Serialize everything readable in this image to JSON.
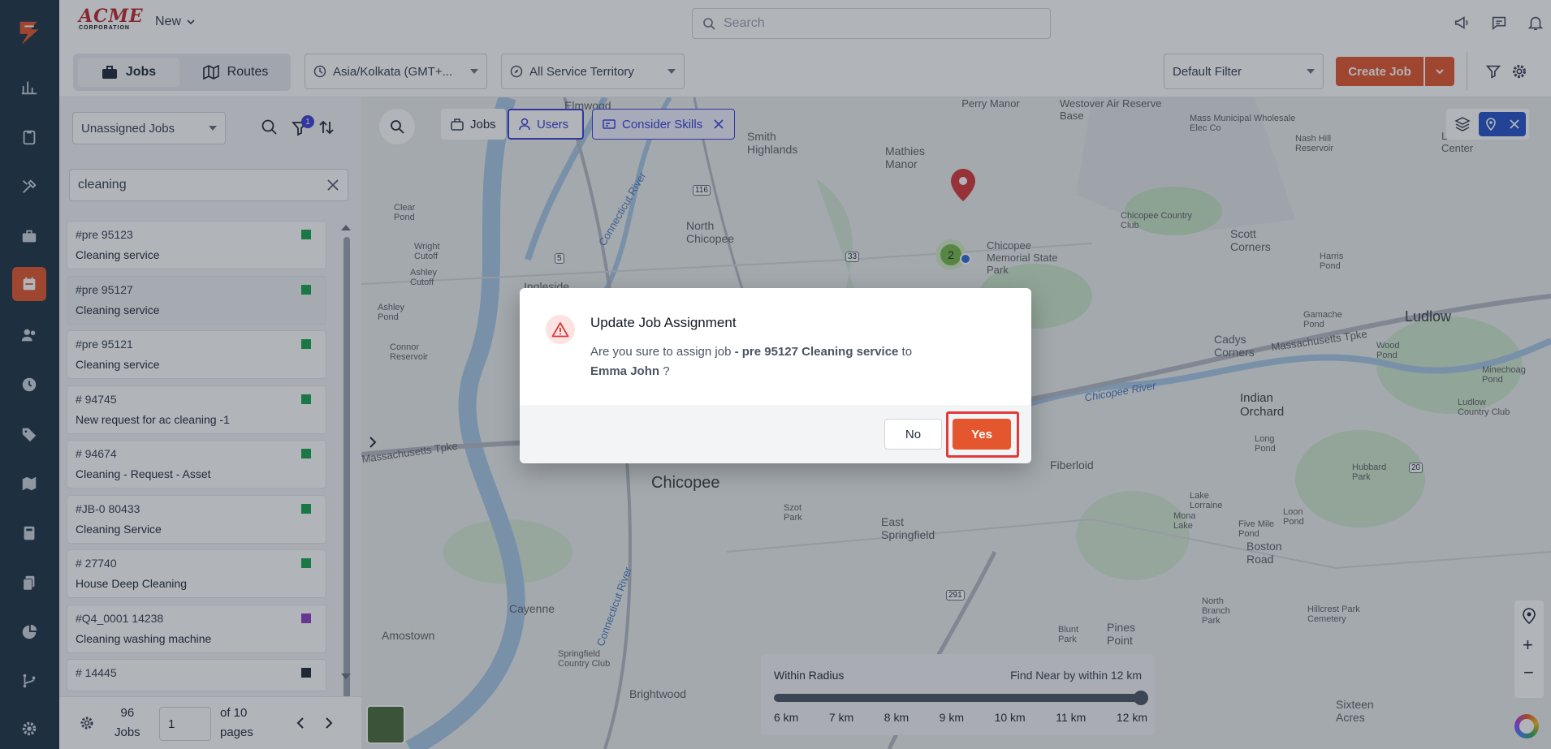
{
  "brand": {
    "logo_text": "ACME",
    "logo_sub": "CORPORATION"
  },
  "topbar": {
    "new_label": "New",
    "search_placeholder": "Search"
  },
  "subbar": {
    "jobs_tab": "Jobs",
    "routes_tab": "Routes",
    "timezone": "Asia/Kolkata (GMT+...",
    "territory": "All Service Territory",
    "default_filter": "Default Filter",
    "create_job": "Create Job"
  },
  "panel": {
    "list_select": "Unassigned Jobs",
    "filter_badge": "1",
    "search_value": "cleaning",
    "jobs": [
      {
        "id": "#pre 95123",
        "name": "Cleaning service",
        "color": "#16a34a"
      },
      {
        "id": "#pre 95127",
        "name": "Cleaning service",
        "color": "#16a34a"
      },
      {
        "id": "#pre 95121",
        "name": "Cleaning service",
        "color": "#16a34a"
      },
      {
        "id": "# 94745",
        "name": "New request for ac cleaning -1",
        "color": "#16a34a"
      },
      {
        "id": "# 94674",
        "name": "Cleaning - Request - Asset",
        "color": "#16a34a"
      },
      {
        "id": "#JB-0 80433",
        "name": "Cleaning Service",
        "color": "#16a34a"
      },
      {
        "id": "# 27740",
        "name": "House Deep Cleaning",
        "color": "#16a34a"
      },
      {
        "id": "#Q4_0001 14238",
        "name": "Cleaning washing machine",
        "color": "#8b3fc2"
      },
      {
        "id": "# 14445",
        "name": "",
        "color": "#1f2937"
      }
    ],
    "pager": {
      "count": "96",
      "count_label": "Jobs",
      "page": "1",
      "of_label": "of 10",
      "pages_label": "pages"
    }
  },
  "map": {
    "chips": {
      "jobs": "Jobs",
      "users": "Users",
      "skills": "Consider Skills"
    },
    "cluster_count": "2",
    "places": [
      "Perry Manor",
      "Westover Air Reserve Base",
      "Mass Municipal Wholesale Elec Co",
      "Nash Hill Reservoir",
      "Ludlow Center",
      "Smith Highlands",
      "Mathies Manor",
      "Elmwood",
      "North Chicopee",
      "Chicopee Country Club",
      "Scott Corners",
      "Harris Pond",
      "Chicopee Memorial State Park",
      "Ludlow",
      "Cadys Corners",
      "Indian Orchard",
      "Chicopee",
      "Fiberloid",
      "East Springfield",
      "Cayenne",
      "Amostown",
      "Pines Point",
      "Brightwood",
      "Boston Road",
      "Sixteen Acres",
      "Clear Pond",
      "Wright Cutoff",
      "Ashley Cutoff",
      "Ashley Pond",
      "Connor Reservoir",
      "Ingleside",
      "Gamache Pond",
      "Minechoag Pond",
      "Long Pond",
      "Lake Lorraine",
      "Five Mile Pond",
      "Loon Pond",
      "Mona Lake",
      "Hubbard Park",
      "North Branch Park",
      "Hillcrest Park Cemetery",
      "Blunt Park",
      "Springfield Country Club",
      "Szot Park",
      "Ludlow Country Club",
      "Wood Pond"
    ],
    "roads": [
      "Connecticut River",
      "Chicopee River",
      "Massachusetts Tpke",
      "Massachusetts Tpke",
      "Connecticut River"
    ],
    "shields": [
      "116",
      "5",
      "33",
      "291",
      "20"
    ],
    "radius": {
      "title": "Within Radius",
      "find": "Find Near by within 12 km",
      "value_km": 12,
      "ticks": [
        "6 km",
        "7 km",
        "8 km",
        "9 km",
        "10 km",
        "11 km",
        "12 km"
      ]
    }
  },
  "dialog": {
    "title": "Update Job Assignment",
    "line1_prefix": "Are you sure to assign job ",
    "job": "- pre 95127 Cleaning service",
    "line1_suffix": " to",
    "user": "Emma John",
    "line2_suffix": " ?",
    "no": "No",
    "yes": "Yes"
  },
  "icons": {
    "rail": [
      "logo-icon",
      "chart-icon",
      "clipboard-icon",
      "tools-icon",
      "briefcase-icon",
      "calendar-icon",
      "users-icon",
      "clock-icon",
      "tag-icon",
      "map-icon",
      "calculator-icon",
      "documents-icon",
      "pie-chart-icon",
      "workflow-icon",
      "settings-icon"
    ]
  }
}
